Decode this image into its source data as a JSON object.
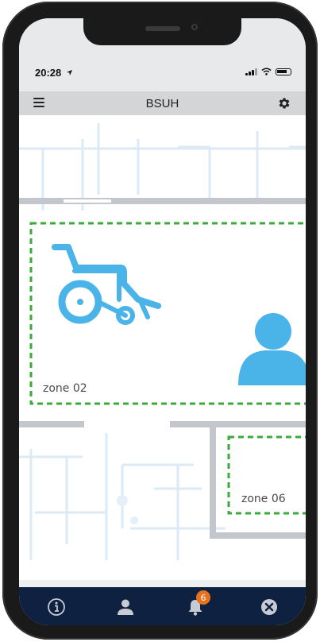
{
  "status_bar": {
    "time": "20:28",
    "location_icon": "location-arrow-icon",
    "signal_icon": "cellular-signal-icon",
    "wifi_icon": "wifi-icon",
    "battery_icon": "battery-icon"
  },
  "header": {
    "title": "BSUH",
    "menu_icon": "hamburger-menu-icon",
    "settings_icon": "gear-icon"
  },
  "map": {
    "zones": [
      {
        "label": "zone 02",
        "icons": [
          "wheelchair-icon",
          "person-icon"
        ]
      },
      {
        "label": "zone 06"
      }
    ],
    "accent_color": "#4ab3e8",
    "zone_border_color": "#3aaa3a"
  },
  "tab_bar": {
    "tabs": [
      {
        "name": "info",
        "icon": "info-circle-icon"
      },
      {
        "name": "profile",
        "icon": "person-icon"
      },
      {
        "name": "notifications",
        "icon": "bell-icon",
        "badge": "6"
      },
      {
        "name": "close",
        "icon": "close-circle-icon"
      }
    ],
    "badge_color": "#e8721c",
    "background_color": "#0f2140"
  }
}
